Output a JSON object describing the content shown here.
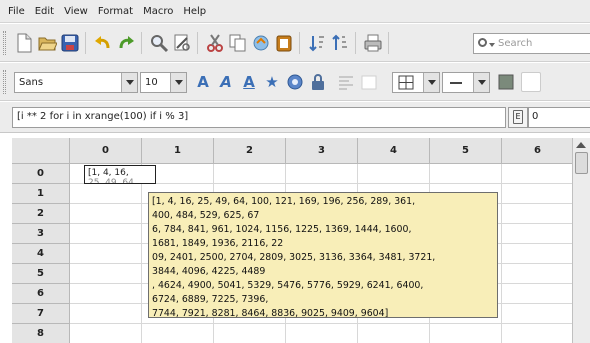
{
  "menu": [
    "File",
    "Edit",
    "View",
    "Format",
    "Macro",
    "Help"
  ],
  "toolbar1": {
    "icons": [
      "new-icon",
      "open-icon",
      "save-icon",
      "undo-icon",
      "redo-icon",
      "find-icon",
      "find-replace-icon",
      "cut-icon",
      "copy-icon",
      "paste-icon",
      "paste-special-icon",
      "sort-ascending-icon",
      "sort-descending-icon",
      "print-icon"
    ],
    "search_placeholder": "Search"
  },
  "toolbar2": {
    "font_name": "Sans",
    "font_size": "10",
    "format_icons": [
      "font-color-icon",
      "italic-font-icon",
      "underline-font-icon",
      "star-icon",
      "gear-icon",
      "lock-icon",
      "align-left-icon",
      "align-right-icon",
      "borders-icon",
      "dash-icon",
      "fill-icon"
    ],
    "colors": {
      "accent": "#3b6fb6",
      "toolbar": "#ececec"
    }
  },
  "formula_bar": {
    "formula": "[i ** 2 for i in xrange(100) if i % 3]",
    "cell_value": "0"
  },
  "grid": {
    "columns": [
      "0",
      "1",
      "2",
      "3",
      "4",
      "5",
      "6"
    ],
    "rows": [
      "0",
      "1",
      "2",
      "3",
      "4",
      "5",
      "6",
      "7",
      "8"
    ],
    "active_cell_text": "[1, 4, 16,",
    "active_cell_overflow": "25, 49, 64"
  },
  "tooltip": {
    "lines": [
      "[1, 4, 16, 25, 49, 64, 100, 121, 169, 196, 256, 289, 361,",
      "400, 484, 529, 625, 67",
      "6, 784, 841, 961, 1024, 1156, 1225, 1369, 1444, 1600,",
      "1681, 1849, 1936, 2116, 22",
      "09, 2401, 2500, 2704, 2809, 3025, 3136, 3364, 3481, 3721,",
      "3844, 4096, 4225, 4489",
      ", 4624, 4900, 5041, 5329, 5476, 5776, 5929, 6241, 6400,",
      "6724, 6889, 7225, 7396,",
      "7744, 7921, 8281, 8464, 8836, 9025, 9409, 9604]"
    ]
  }
}
